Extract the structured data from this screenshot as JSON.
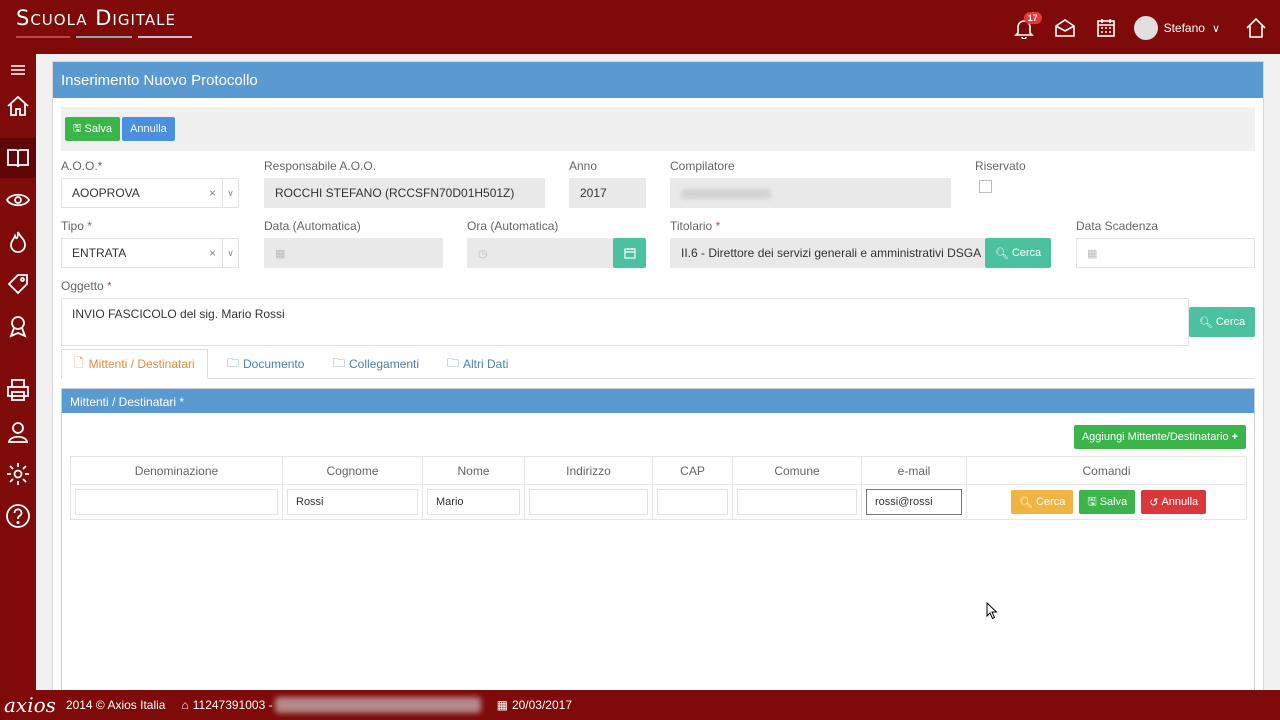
{
  "app": {
    "brand": "Scuola Digitale"
  },
  "header": {
    "notification_count": "17",
    "user_name": "Stefano"
  },
  "page": {
    "title": "Inserimento Nuovo Protocollo"
  },
  "toolbar": {
    "save_label": "Salva",
    "cancel_label": "Annulla"
  },
  "form": {
    "aoo_label": "A.O.O.*",
    "aoo_value": "AOOPROVA",
    "responsabile_label": "Responsabile A.O.O.",
    "responsabile_value": "ROCCHI STEFANO (RCCSFN70D01H501Z)",
    "anno_label": "Anno",
    "anno_value": "2017",
    "compilatore_label": "Compilatore",
    "riservato_label": "Riservato",
    "tipo_label": "Tipo",
    "tipo_value": "ENTRATA",
    "data_label": "Data (Automatica)",
    "ora_label": "Ora (Automatica)",
    "titolario_label": "Titolario",
    "titolario_value": "II.6 - Direttore dei servizi generali e amministrativi DSGA",
    "cerca_label": "Cerca",
    "scadenza_label": "Data Scadenza",
    "oggetto_label": "Oggetto",
    "oggetto_value": "INVIO FASCICOLO del sig. Mario Rossi",
    "required_mark": "*"
  },
  "tabs": [
    {
      "label": "Mittenti / Destinatari"
    },
    {
      "label": "Documento"
    },
    {
      "label": "Collegamenti"
    },
    {
      "label": "Altri Dati"
    }
  ],
  "mittenti": {
    "title": "Mittenti / Destinatari *",
    "add_label": "Aggiungi Mittente/Destinatario",
    "columns": [
      "Denominazione",
      "Cognome",
      "Nome",
      "Indirizzo",
      "CAP",
      "Comune",
      "e-mail",
      "Comandi"
    ],
    "row": {
      "denominazione": "",
      "cognome": "Rossi",
      "nome": "Mario",
      "indirizzo": "",
      "cap": "",
      "comune": "",
      "email": "rossi@rossi"
    },
    "cerca_label": "Cerca",
    "salva_label": "Salva",
    "annulla_label": "Annulla"
  },
  "footer": {
    "logo": "axios",
    "copyright": "2014 © Axios Italia",
    "phone": "11247391003 -",
    "date": "20/03/2017"
  },
  "colors": {
    "brand": "#7e0a0a",
    "header_blue": "#5b9ad0",
    "green": "#3bb54a",
    "teal": "#4cc1a0",
    "orange": "#f0b443",
    "red": "#d9373a"
  }
}
